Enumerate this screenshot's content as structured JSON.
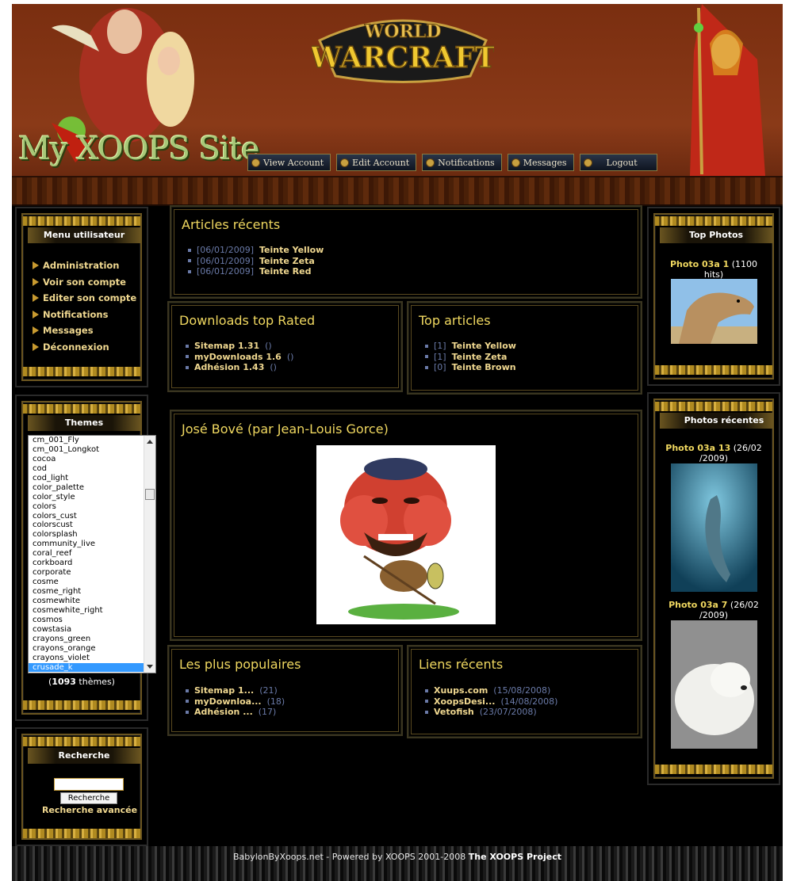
{
  "header": {
    "logo_text": "World of Warcraft",
    "site_name": "My XOOPS Site",
    "nav": [
      "View Account",
      "Edit Account",
      "Notifications",
      "Messages",
      "Logout"
    ]
  },
  "user_menu": {
    "title": "Menu utilisateur",
    "items": [
      "Administration",
      "Voir son compte",
      "Editer son compte",
      "Notifications",
      "Messages",
      "Déconnexion"
    ]
  },
  "themes": {
    "title": "Themes",
    "options": [
      "cm_001_Fly",
      "cm_001_Longkot",
      "cocoa",
      "cod",
      "cod_light",
      "color_palette",
      "color_style",
      "colors",
      "colors_cust",
      "colorscust",
      "colorsplash",
      "community_live",
      "coral_reef",
      "corkboard",
      "corporate",
      "cosme",
      "cosme_right",
      "cosmewhite",
      "cosmewhite_right",
      "cosmos",
      "cowstasia",
      "crayons_green",
      "crayons_orange",
      "crayons_violet",
      "crusade_k"
    ],
    "selected": "crusade_k",
    "count": "1093",
    "count_suffix": " thèmes)",
    "count_prefix": "("
  },
  "search": {
    "title": "Recherche",
    "input_value": "",
    "button": "Recherche",
    "advanced": "Recherche avancée"
  },
  "recent_articles": {
    "title": "Articles récents",
    "items": [
      {
        "date": "[06/01/2009]",
        "title": "Teinte Yellow"
      },
      {
        "date": "[06/01/2009]",
        "title": "Teinte Zeta"
      },
      {
        "date": "[06/01/2009]",
        "title": "Teinte Red"
      }
    ]
  },
  "downloads_top": {
    "title": "Downloads top Rated",
    "items": [
      {
        "title": "Sitemap 1.31",
        "meta": "()"
      },
      {
        "title": "myDownloads 1.6",
        "meta": "()"
      },
      {
        "title": "Adhésion 1.43",
        "meta": "()"
      }
    ]
  },
  "top_articles": {
    "title": "Top articles",
    "items": [
      {
        "rank": "[1]",
        "title": "Teinte Yellow"
      },
      {
        "rank": "[1]",
        "title": "Teinte Zeta"
      },
      {
        "rank": "[0]",
        "title": "Teinte Brown"
      }
    ]
  },
  "feature": {
    "title": "José Bové (par Jean-Louis Gorce)"
  },
  "popular": {
    "title": "Les plus populaires",
    "items": [
      {
        "title": "Sitemap 1...",
        "meta": "(21)"
      },
      {
        "title": "myDownloa...",
        "meta": "(18)"
      },
      {
        "title": "Adhésion ...",
        "meta": "(17)"
      }
    ]
  },
  "recent_links": {
    "title": "Liens récents",
    "items": [
      {
        "title": "Xuups.com",
        "meta": "(15/08/2008)"
      },
      {
        "title": "XoopsDesi...",
        "meta": "(14/08/2008)"
      },
      {
        "title": "Vetofish",
        "meta": "(23/07/2008)"
      }
    ]
  },
  "top_photos": {
    "title": "Top Photos",
    "items": [
      {
        "title": "Photo 03a 1",
        "meta": "(1100 hits)"
      }
    ]
  },
  "recent_photos": {
    "title": "Photos récentes",
    "items": [
      {
        "title": "Photo 03a 13",
        "meta": "(26/02 /2009)"
      },
      {
        "title": "Photo 03a 7",
        "meta": "(26/02 /2009)"
      }
    ]
  },
  "footer": {
    "text": "BabylonByXoops.net - Powered by XOOPS 2001-2008 ",
    "project": "The XOOPS Project"
  },
  "colors": {
    "header_bg": "#8a3a18",
    "link": "#f0d890",
    "title": "#f0d860",
    "muted": "#6a7aa8",
    "frame": "#6a5520"
  }
}
